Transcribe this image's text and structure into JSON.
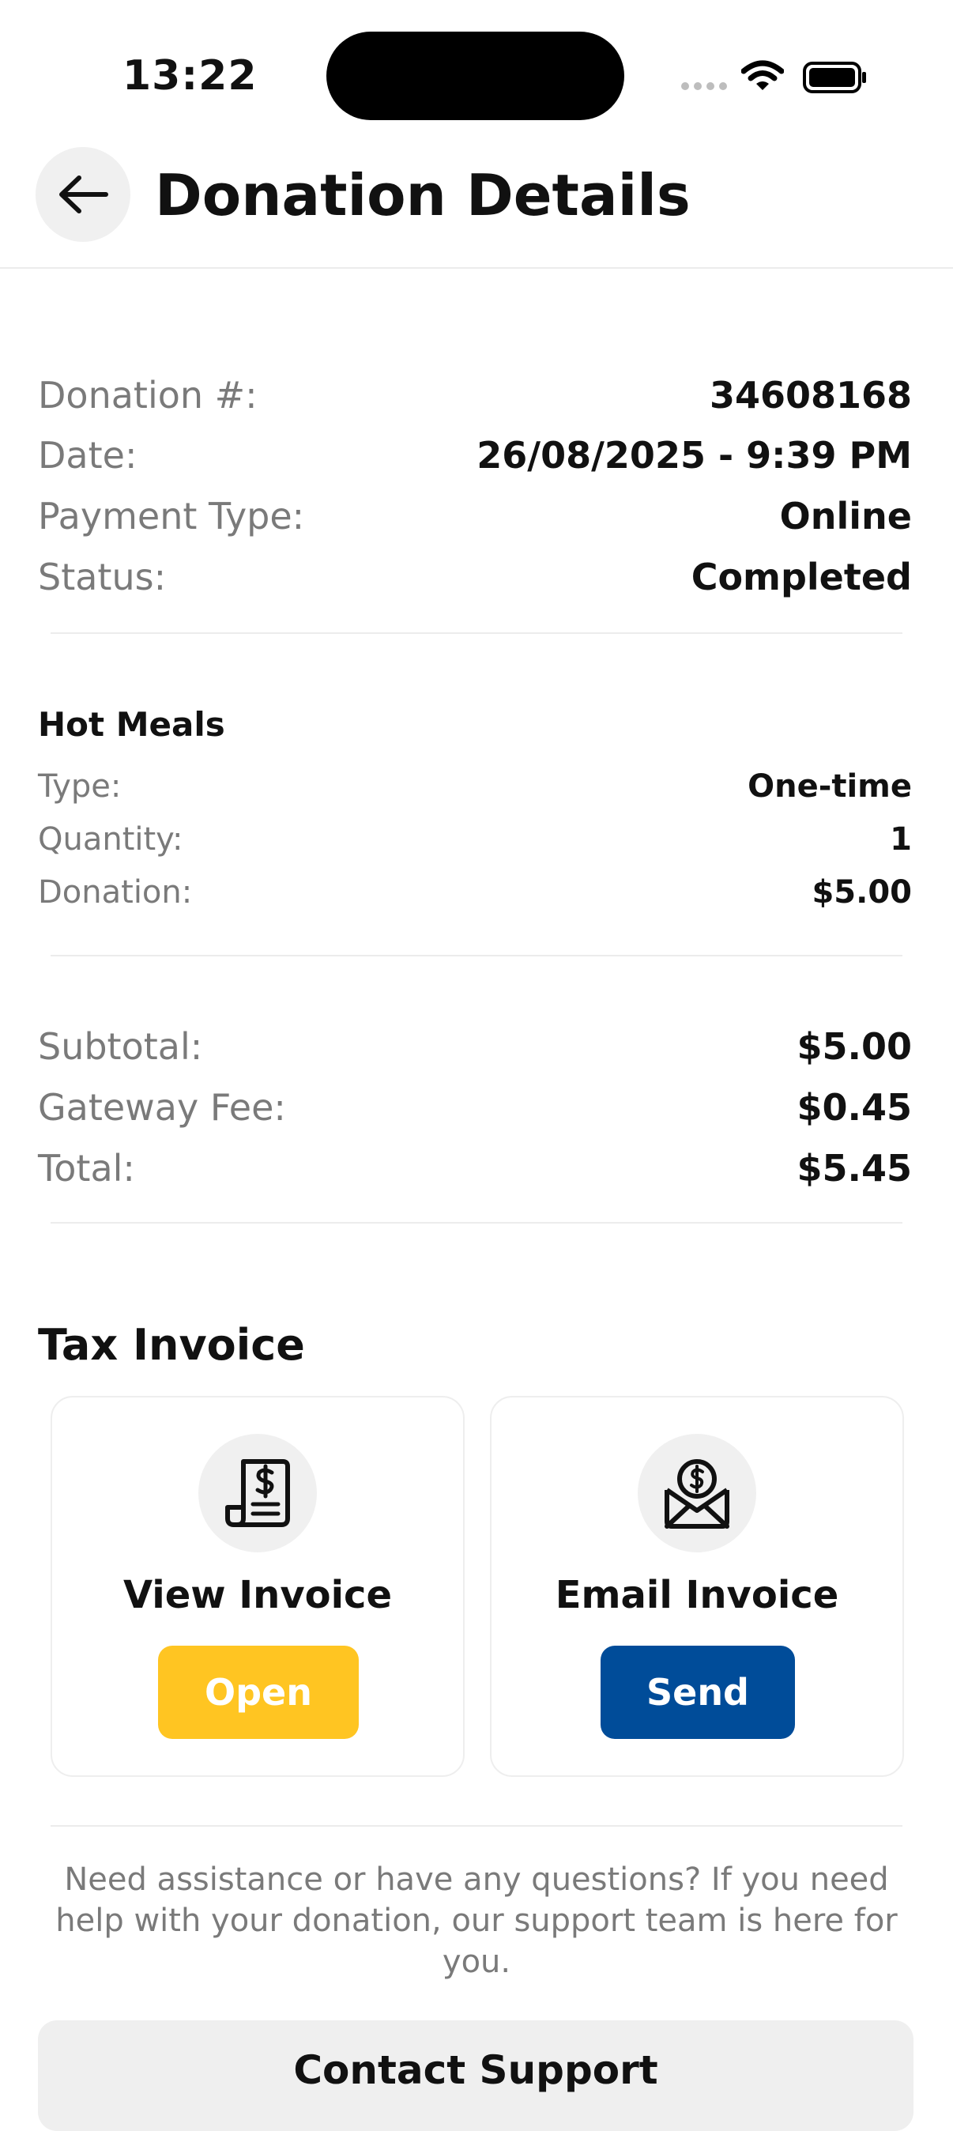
{
  "status_bar": {
    "time": "13:22"
  },
  "header": {
    "title": "Donation Details"
  },
  "summary": [
    {
      "label": "Donation #:",
      "value": "34608168"
    },
    {
      "label": "Date:",
      "value": "26/08/2025 - 9:39 PM"
    },
    {
      "label": "Payment Type:",
      "value": "Online"
    },
    {
      "label": "Status:",
      "value": "Completed"
    }
  ],
  "item": {
    "name": "Hot Meals",
    "rows": [
      {
        "label": "Type:",
        "value": "One-time"
      },
      {
        "label": "Quantity:",
        "value": "1"
      },
      {
        "label": "Donation:",
        "value": "$5.00"
      }
    ]
  },
  "totals": [
    {
      "label": "Subtotal:",
      "value": "$5.00"
    },
    {
      "label": "Gateway Fee:",
      "value": "$0.45"
    },
    {
      "label": "Total:",
      "value": "$5.45"
    }
  ],
  "tax_invoice": {
    "heading": "Tax Invoice",
    "view": {
      "title": "View Invoice",
      "button": "Open",
      "color": "#FFC522"
    },
    "email": {
      "title": "Email Invoice",
      "button": "Send",
      "color": "#004C99"
    }
  },
  "support": {
    "text": "Need assistance or have any questions? If you need help with your donation, our support team is here for you.",
    "button": "Contact Support"
  }
}
